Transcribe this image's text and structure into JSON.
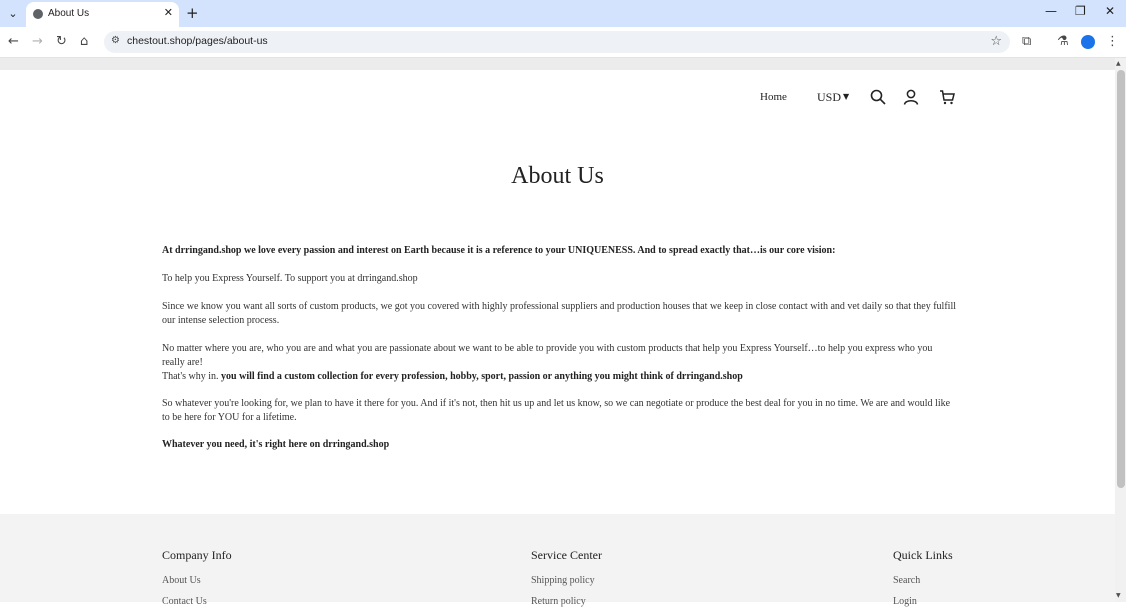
{
  "browser": {
    "tab_title": "About Us",
    "url": "chestout.shop/pages/about-us"
  },
  "header": {
    "home": "Home",
    "currency": "USD"
  },
  "page": {
    "title": "About Us",
    "p1": "At drringand.shop we love every passion and interest on Earth because it is a reference to your UNIQUENESS. And to spread exactly that…is our core vision:",
    "p2": "To help you Express Yourself. To support you at drringand.shop",
    "p3": "Since we know you want all sorts of custom products, we got you covered with highly professional suppliers and production houses that we keep in close contact with and vet daily so that they fulfill our intense selection process.",
    "p4": "No matter where you are, who you are and what you are passionate about we want to be able to provide you with custom products that help you Express Yourself…to help you express who you really are!",
    "p5_lead": "That's why in. ",
    "p5_bold": "you will find a custom collection for every profession, hobby, sport, passion or anything you might think of drringand.shop",
    "p6": "So whatever you're looking for, we plan to have it there for you. And if it's not, then hit us up and let us know, so we can negotiate or produce the best deal for you in no time. We are and would like to be here for YOU for a lifetime.",
    "p7": "Whatever you need, it's right here on drringand.shop"
  },
  "footer": {
    "company_info": {
      "heading": "Company Info",
      "links": [
        "About Us",
        "Contact Us"
      ]
    },
    "service_center": {
      "heading": "Service Center",
      "links": [
        "Shipping policy",
        "Return policy"
      ]
    },
    "quick_links": {
      "heading": "Quick Links",
      "links": [
        "Search",
        "Login"
      ]
    }
  }
}
